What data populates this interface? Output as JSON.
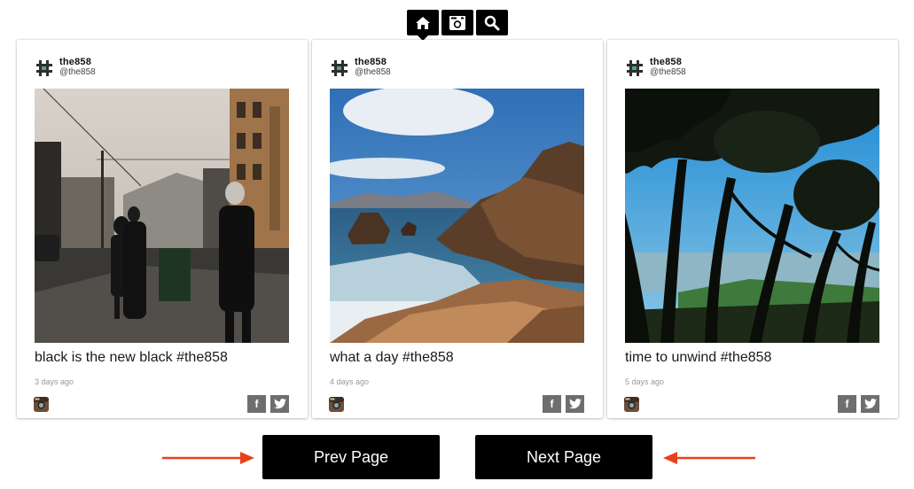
{
  "nav": {
    "items": [
      {
        "icon": "home-icon",
        "active": true
      },
      {
        "icon": "instagram-icon",
        "active": false
      },
      {
        "icon": "search-icon",
        "active": false
      }
    ]
  },
  "colors": {
    "nav_bg": "#000000",
    "button_bg": "#000000",
    "share_bg": "#6e6e6e",
    "arrow": "#e8401c"
  },
  "cards": [
    {
      "user_name": "the858",
      "user_handle": "@the858",
      "caption": "black is the new black #the858",
      "timestamp": "3 days ago",
      "photo": "street-scene"
    },
    {
      "user_name": "the858",
      "user_handle": "@the858",
      "caption": "what a day #the858",
      "timestamp": "4 days ago",
      "photo": "coast-rocks"
    },
    {
      "user_name": "the858",
      "user_handle": "@the858",
      "caption": "time to unwind #the858",
      "timestamp": "5 days ago",
      "photo": "cypress-trees"
    }
  ],
  "share": {
    "facebook_label": "f"
  },
  "pager": {
    "prev_label": "Prev Page",
    "next_label": "Next Page"
  }
}
